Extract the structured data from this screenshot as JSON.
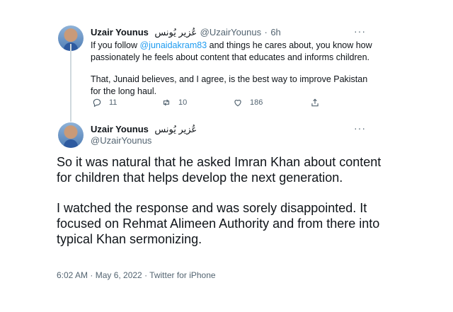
{
  "tweet1": {
    "display_name": "Uzair Younus",
    "urdu_name": "عُزیر یُونس",
    "handle": "@UzairYounus",
    "separator": "·",
    "time": "6h",
    "text_before_mention": "If you follow ",
    "mention": "@junaidakram83",
    "text_after_mention": " and things he cares about, you know how passionately he feels about content that educates and informs children.",
    "paragraph2": "That, Junaid believes, and I agree, is the best way to improve Pakistan for the long haul.",
    "replies": "11",
    "retweets": "10",
    "likes": "186",
    "more": "···"
  },
  "tweet2": {
    "display_name": "Uzair Younus",
    "urdu_name": "عُزیر یُونس",
    "handle": "@UzairYounus",
    "paragraph1": "So it was natural that he asked Imran Khan about content for children that helps develop the next generation.",
    "paragraph2": "I watched the response and was sorely disappointed. It focused on Rehmat Alimeen Authority and from there into typical Khan sermonizing.",
    "timestamp": "6:02 AM · May 6, 2022 · Twitter for iPhone",
    "more": "···"
  },
  "icons": {
    "reply": "reply-icon",
    "retweet": "retweet-icon",
    "like": "heart-icon",
    "share": "share-icon",
    "avatar": "profile-photo"
  },
  "colors": {
    "link": "#1d9bf0",
    "muted": "#536471",
    "text": "#0f1419"
  }
}
